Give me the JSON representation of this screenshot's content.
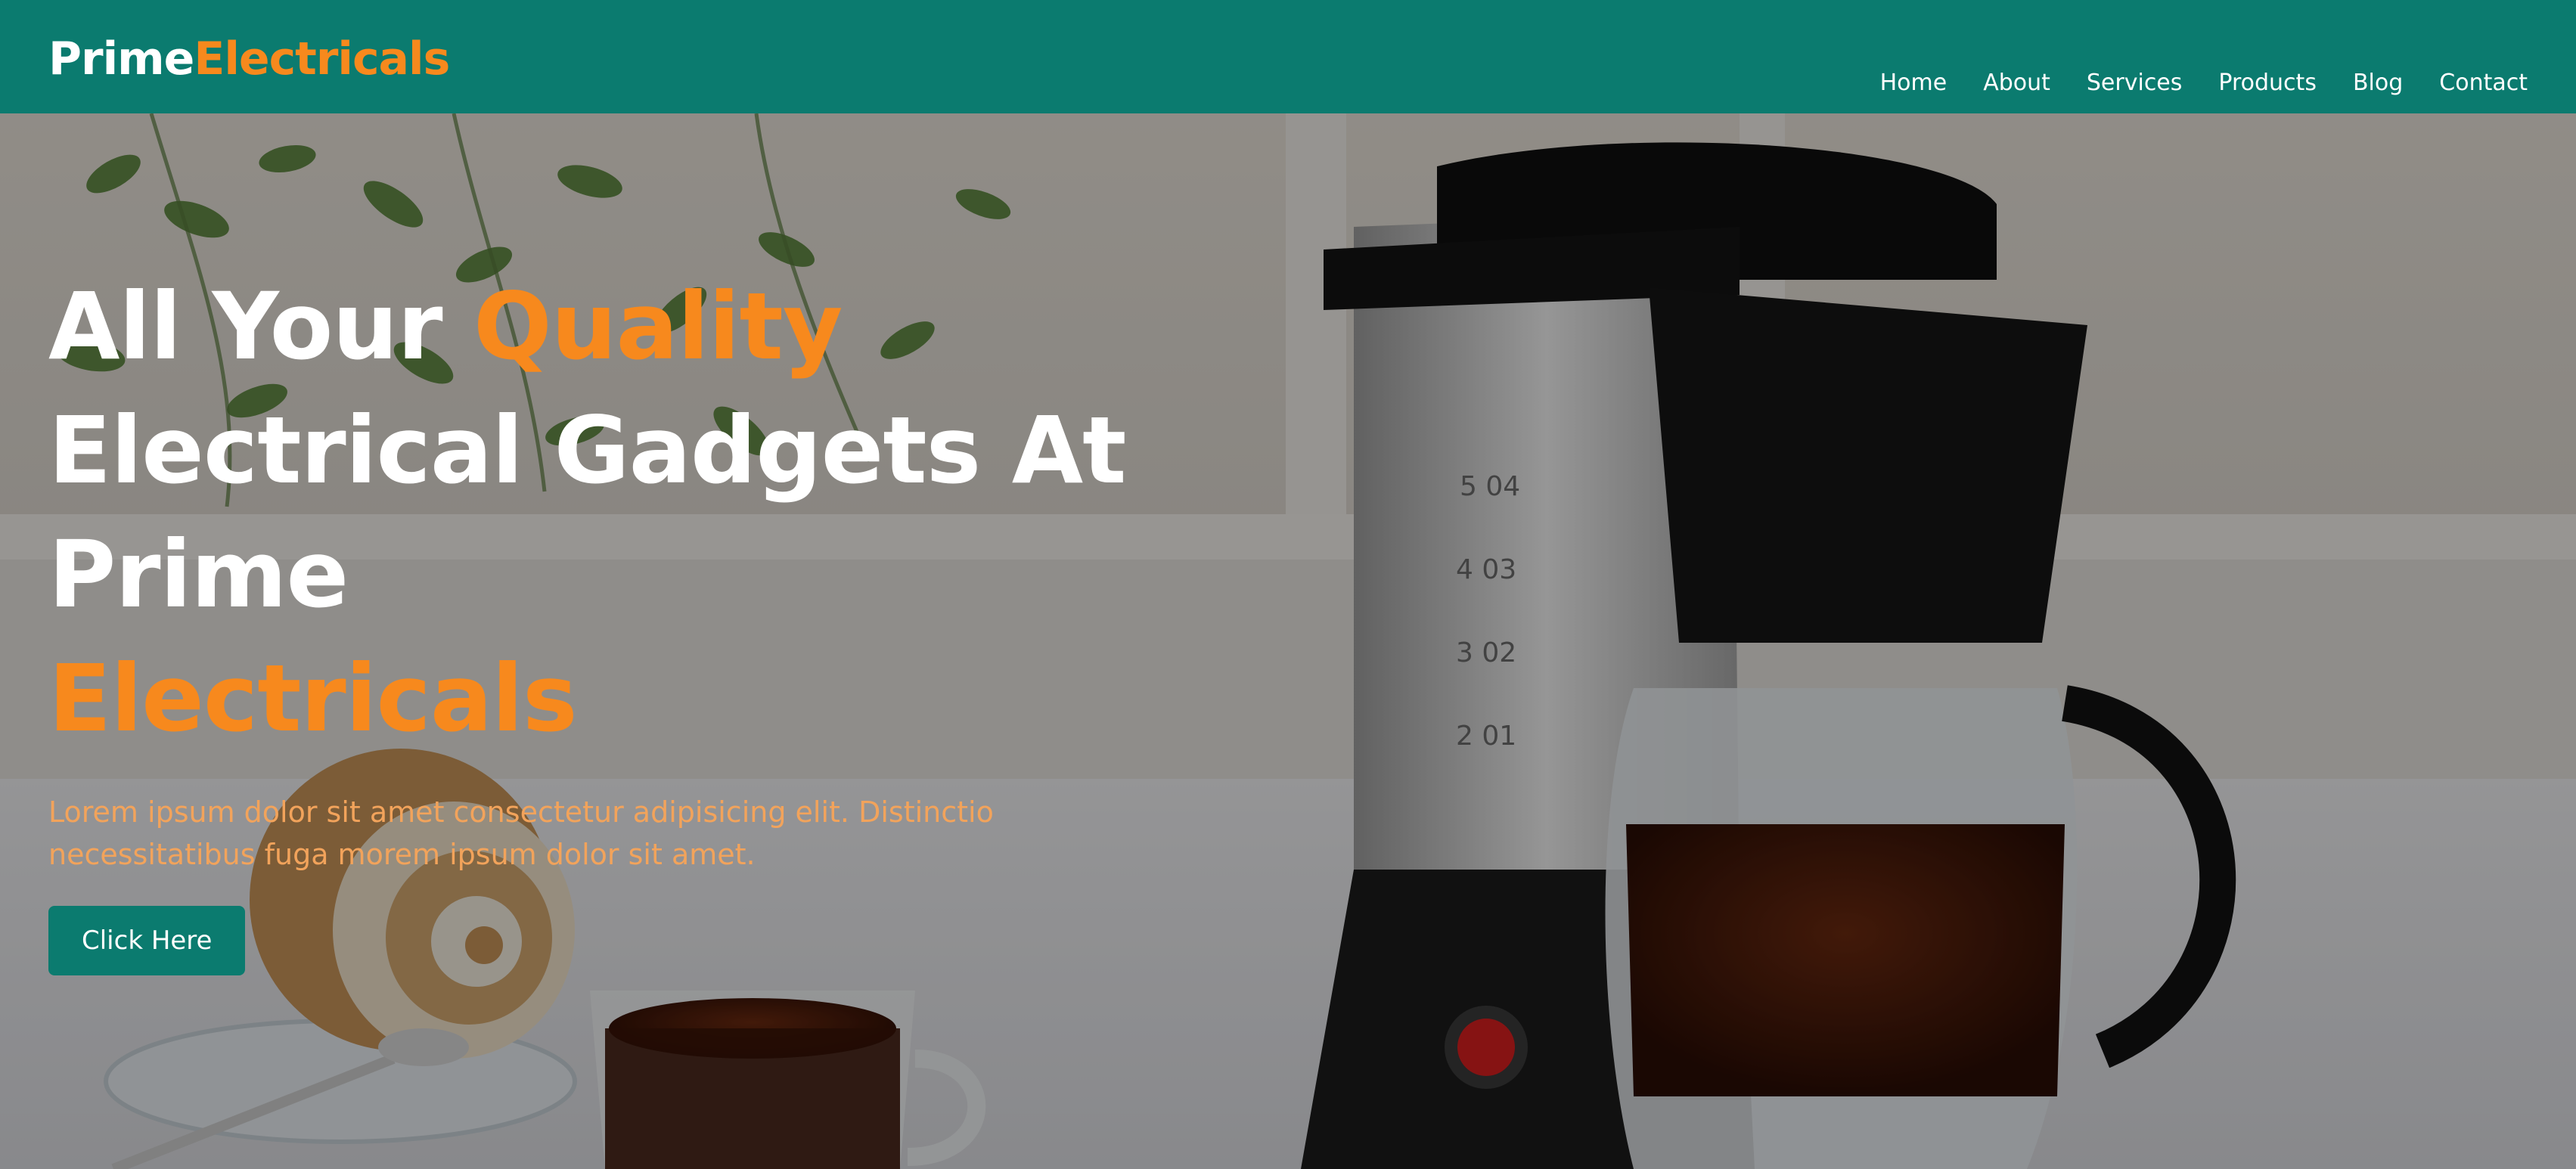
{
  "brand": {
    "part1": "Prime",
    "part2": "Electricals"
  },
  "nav": {
    "items": [
      {
        "label": "Home"
      },
      {
        "label": "About"
      },
      {
        "label": "Services"
      },
      {
        "label": "Products"
      },
      {
        "label": "Blog"
      },
      {
        "label": "Contact"
      }
    ]
  },
  "hero": {
    "title_part1": "All Your ",
    "title_highlight1": "Quality",
    "title_part2": " Electrical Gadgets At Prime ",
    "title_highlight2": "Electricals",
    "subtitle": "Lorem ipsum dolor sit amet consectetur adipisicing elit. Distinctio necessitatibus fuga morem ipsum dolor sit amet.",
    "cta_label": "Click Here"
  },
  "colors": {
    "primary": "#0b7b6f",
    "accent": "#f7891d",
    "subtitle": "#f2a35b"
  }
}
